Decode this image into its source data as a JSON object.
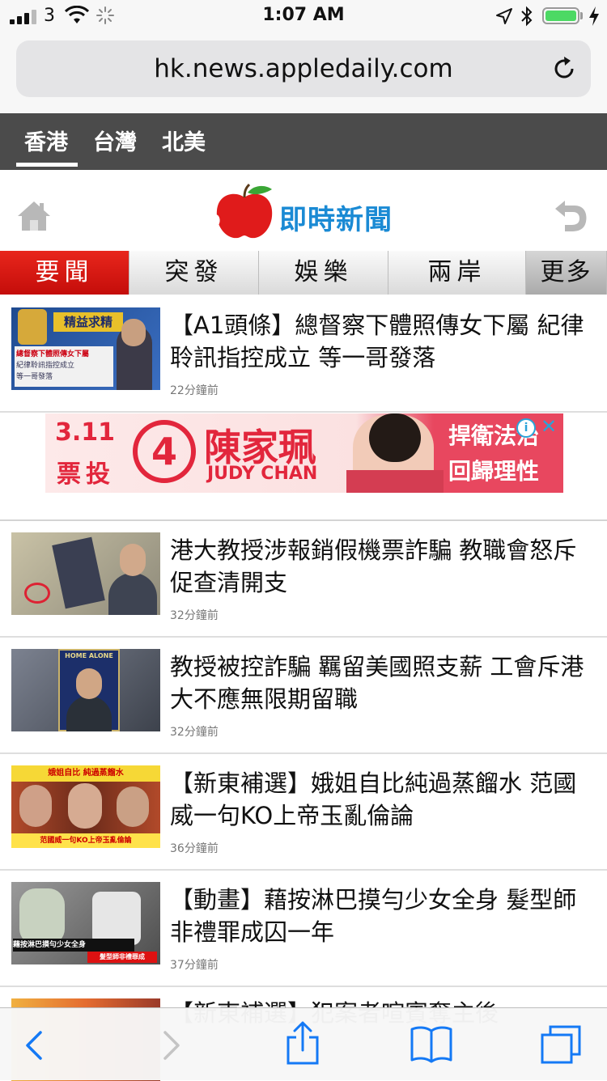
{
  "status_bar": {
    "carrier": "3",
    "time": "1:07 AM",
    "battery_level": 1.0
  },
  "browser": {
    "url": "hk.news.appledaily.com"
  },
  "region_tabs": [
    "香港",
    "台灣",
    "北美"
  ],
  "logo": {
    "text": "即時新聞"
  },
  "categories": [
    "要聞",
    "突發",
    "娛樂",
    "兩岸",
    "更多"
  ],
  "articles": [
    {
      "title": "【A1頭條】總督察下體照傳女下屬 紀律聆訊指控成立 等一哥發落",
      "time": "22分鐘前",
      "thumb_text": [
        "精益求精",
        "總督察下體照傳女下屬",
        "紀律聆訊指控成立",
        "等一哥發落"
      ]
    },
    {
      "title": "港大教授涉報銷假機票詐騙 教職會怒斥促查清開支",
      "time": "32分鐘前",
      "thumb_text": []
    },
    {
      "title": "教授被控詐騙 羈留美國照支薪 工會斥港大不應無限期留職",
      "time": "32分鐘前",
      "thumb_text": [
        "HOME ALONE"
      ]
    },
    {
      "title": "【新東補選】娥姐自比純過蒸餾水 范國威一句KO上帝玉亂倫論",
      "time": "36分鐘前",
      "thumb_text": [
        "娥姐自比 純過蒸餾水",
        "范國威一句KO上帝玉亂倫論"
      ]
    },
    {
      "title": "【動畫】藉按淋巴摸勻少女全身 髮型師非禮罪成囚一年",
      "time": "37分鐘前",
      "thumb_text": [
        "藉按淋巴摸勻少女全身",
        "髮型師非禮罪成"
      ]
    },
    {
      "title": "【新東補選】犯案者喧賓奪主後",
      "time": "",
      "thumb_text": []
    }
  ],
  "ad": {
    "date": "3.11",
    "vote": "票投",
    "number": "4",
    "name_zh": "陳家珮",
    "name_en": "JUDY CHAN",
    "slogan": [
      "捍衛法治",
      "回歸理性"
    ],
    "close": "✕",
    "info": "i"
  },
  "toolbar": {
    "icons": [
      "back-icon",
      "forward-icon",
      "share-icon",
      "bookmarks-icon",
      "tabs-icon"
    ]
  },
  "colors": {
    "accent_red": "#d41810",
    "logo_blue": "#1a8ad4",
    "region_bar": "#4b4b4b",
    "ad_pink": "#e8475f"
  }
}
